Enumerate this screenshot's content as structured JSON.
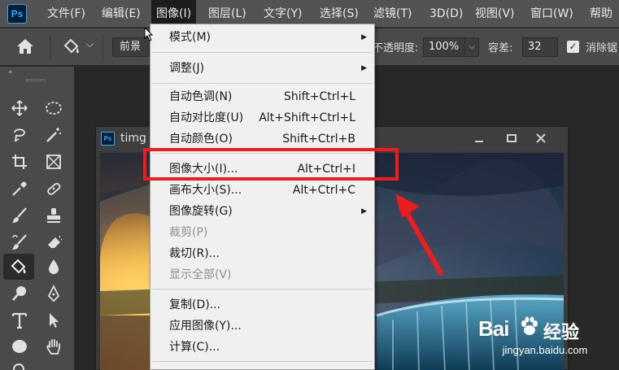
{
  "app": {
    "logo_text": "Ps"
  },
  "menubar": {
    "items": [
      {
        "label": "文件(F)"
      },
      {
        "label": "编辑(E)"
      },
      {
        "label": "图像(I)"
      },
      {
        "label": "图层(L)"
      },
      {
        "label": "文字(Y)"
      },
      {
        "label": "选择(S)"
      },
      {
        "label": "滤镜(T)"
      },
      {
        "label": "3D(D)"
      },
      {
        "label": "视图(V)"
      },
      {
        "label": "窗口(W)"
      },
      {
        "label": "帮助"
      }
    ]
  },
  "options": {
    "fill_source": "前景",
    "opacity_label": "不透明度:",
    "opacity_value": "100%",
    "tolerance_label": "容差:",
    "tolerance_value": "32",
    "antialias_label": "消除锯",
    "antialias_checked": true
  },
  "document": {
    "title": "timg",
    "window_buttons": [
      "minimize",
      "maximize",
      "close"
    ]
  },
  "image_menu": {
    "items": [
      {
        "label": "模式(M)",
        "shortcut": "",
        "submenu": true,
        "enabled": true
      },
      {
        "label": "调整(J)",
        "shortcut": "",
        "submenu": true,
        "enabled": true
      },
      {
        "label": "自动色调(N)",
        "shortcut": "Shift+Ctrl+L",
        "submenu": false,
        "enabled": true
      },
      {
        "label": "自动对比度(U)",
        "shortcut": "Alt+Shift+Ctrl+L",
        "submenu": false,
        "enabled": true
      },
      {
        "label": "自动颜色(O)",
        "shortcut": "Shift+Ctrl+B",
        "submenu": false,
        "enabled": true
      },
      {
        "label": "图像大小(I)...",
        "shortcut": "Alt+Ctrl+I",
        "submenu": false,
        "enabled": true,
        "highlighted": true
      },
      {
        "label": "画布大小(S)...",
        "shortcut": "Alt+Ctrl+C",
        "submenu": false,
        "enabled": true
      },
      {
        "label": "图像旋转(G)",
        "shortcut": "",
        "submenu": true,
        "enabled": true
      },
      {
        "label": "裁剪(P)",
        "shortcut": "",
        "submenu": false,
        "enabled": false
      },
      {
        "label": "裁切(R)...",
        "shortcut": "",
        "submenu": false,
        "enabled": true
      },
      {
        "label": "显示全部(V)",
        "shortcut": "",
        "submenu": false,
        "enabled": false
      },
      {
        "label": "复制(D)...",
        "shortcut": "",
        "submenu": false,
        "enabled": true
      },
      {
        "label": "应用图像(Y)...",
        "shortcut": "",
        "submenu": false,
        "enabled": true
      },
      {
        "label": "计算(C)...",
        "shortcut": "",
        "submenu": false,
        "enabled": true
      }
    ]
  },
  "watermark": {
    "brand_prefix": "Bai",
    "brand_suffix": "经验",
    "url": "jingyan.baidu.com"
  },
  "colors": {
    "highlight": "#ee1c1c",
    "menu_bg": "#f0f0f0",
    "ps_blue": "#31a8ff"
  }
}
